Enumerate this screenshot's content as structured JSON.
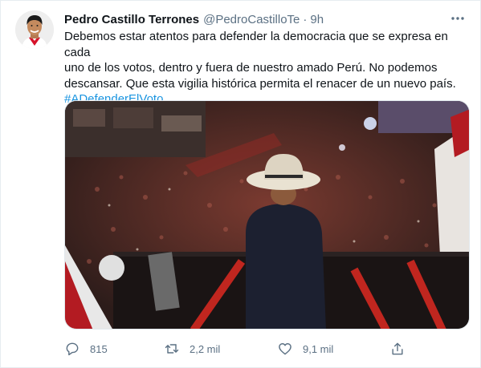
{
  "tweet": {
    "author_name": "Pedro Castillo Terrones",
    "author_handle": "@PedroCastilloTe",
    "separator": "·",
    "time": "9h",
    "text_lines": [
      "Debemos estar atentos para defender la democracia que se expresa en cada",
      "uno de los votos, dentro y fuera de nuestro amado Perú. No podemos",
      "descansar. Que esta vigilia histórica permita el renacer de un nuevo país."
    ],
    "hashtag": "#ADefenderElVoto"
  },
  "actions": {
    "reply_count": "815",
    "retweet_count": "2,2 mil",
    "like_count": "9,1 mil"
  },
  "icons": {
    "more": "more-dots-icon",
    "reply": "reply-bubble-icon",
    "retweet": "retweet-icon",
    "like": "heart-icon",
    "share": "share-icon"
  },
  "colors": {
    "text": "#0f1419",
    "muted": "#5b7083",
    "link": "#1b95e0",
    "border": "#e6ecf0"
  }
}
